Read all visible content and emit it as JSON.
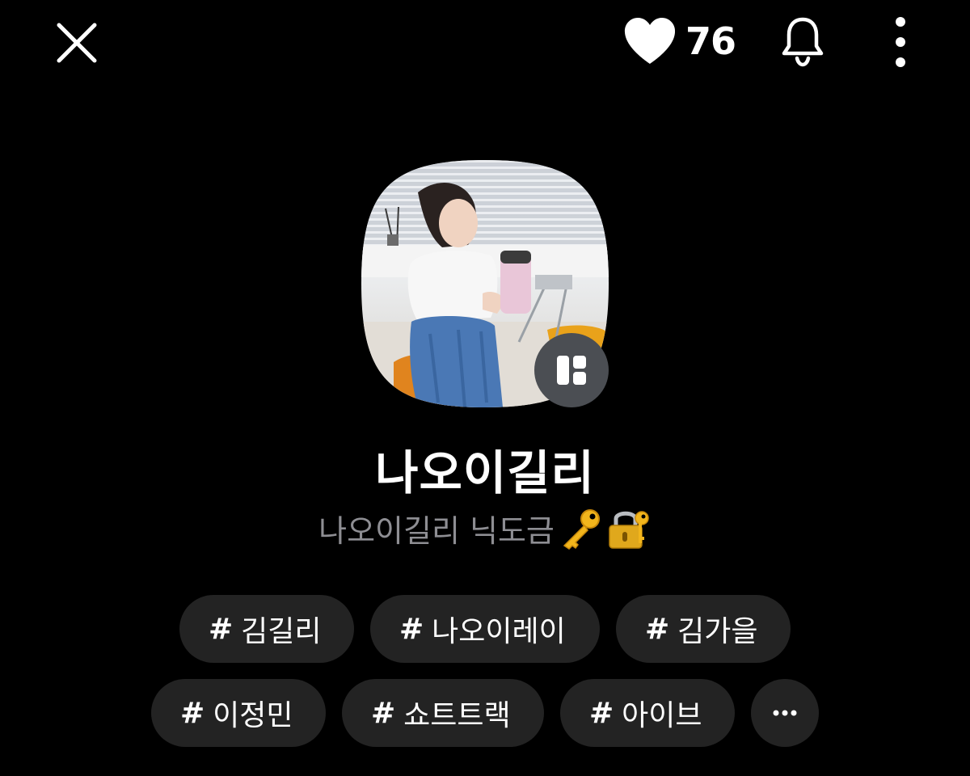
{
  "header": {
    "close_icon": "close-icon",
    "like_icon": "heart-icon",
    "like_count": "76",
    "bell_icon": "bell-icon",
    "more_icon": "more-vertical-icon"
  },
  "profile": {
    "name": "나오이길리",
    "status_text": "나오이길리 닉도금",
    "status_emojis": [
      "key-emoji",
      "locked-with-key-emoji"
    ],
    "avatar_badge_icon": "gallery-grid-icon"
  },
  "tags": {
    "hash": "#",
    "row1": [
      "김길리",
      "나오이레이",
      "김가을"
    ],
    "row2": [
      "이정민",
      "쇼트트랙",
      "아이브"
    ],
    "more_label": "···"
  },
  "colors": {
    "background": "#000000",
    "tag_background": "#232323",
    "status_text": "#8e8e93",
    "badge_background": "#4b4e53"
  }
}
